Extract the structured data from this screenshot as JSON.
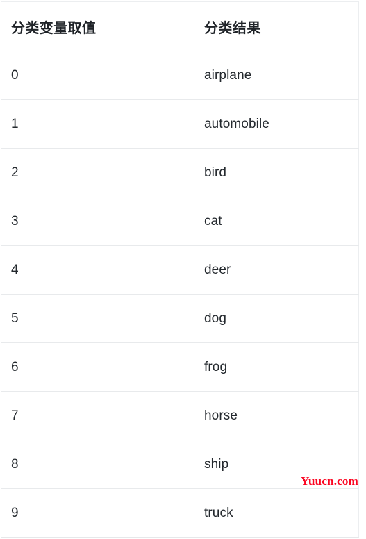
{
  "table": {
    "headers": {
      "value_column": "分类变量取值",
      "result_column": "分类结果"
    },
    "rows": [
      {
        "value": "0",
        "result": "airplane"
      },
      {
        "value": "1",
        "result": "automobile"
      },
      {
        "value": "2",
        "result": "bird"
      },
      {
        "value": "3",
        "result": "cat"
      },
      {
        "value": "4",
        "result": "deer"
      },
      {
        "value": "5",
        "result": "dog"
      },
      {
        "value": "6",
        "result": "frog"
      },
      {
        "value": "7",
        "result": "horse"
      },
      {
        "value": "8",
        "result": "ship"
      },
      {
        "value": "9",
        "result": "truck"
      }
    ]
  },
  "watermark": {
    "text": "Yuucn.com",
    "color": "#fb0521"
  },
  "colors": {
    "text": "#24292e",
    "header_text": "#1f2328",
    "border": "#e8eaec",
    "background": "#ffffff"
  }
}
